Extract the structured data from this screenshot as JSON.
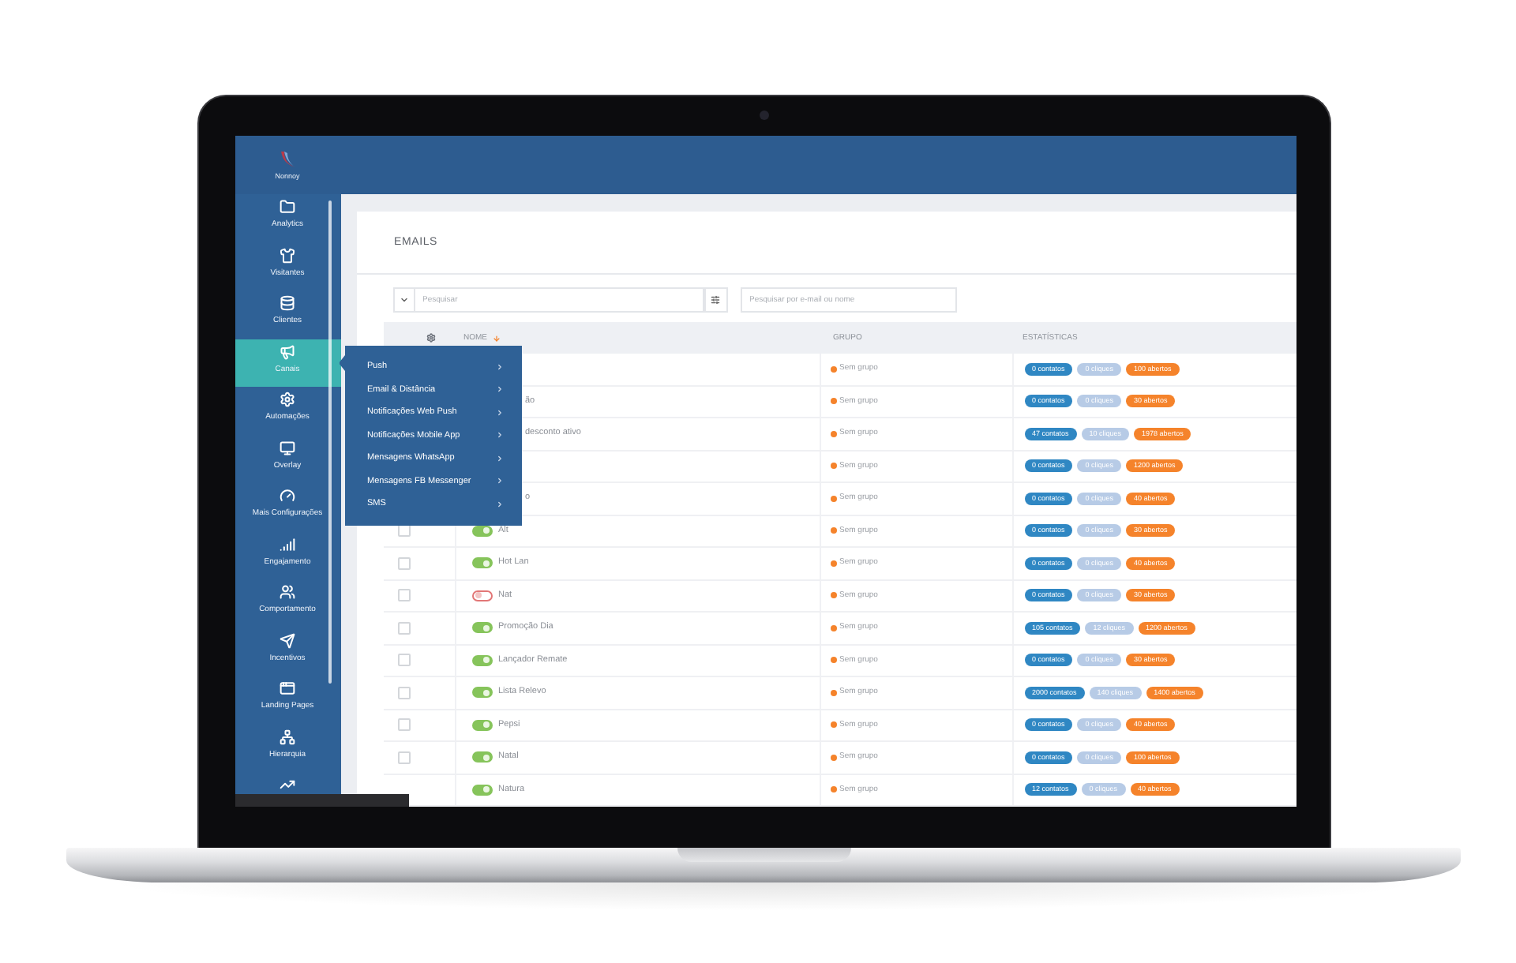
{
  "app": {
    "logo_text": "Nonnoy"
  },
  "sidebar": {
    "items": [
      {
        "label": "Analytics",
        "selected": false
      },
      {
        "label": "Visitantes",
        "selected": false
      },
      {
        "label": "Clientes",
        "selected": false
      },
      {
        "label": "Canais",
        "selected": true
      },
      {
        "label": "Automações",
        "selected": false
      },
      {
        "label": "Overlay",
        "selected": false
      },
      {
        "label": "Mais Configurações",
        "selected": false
      },
      {
        "label": "Engajamento",
        "selected": false
      },
      {
        "label": "Comportamento",
        "selected": false
      },
      {
        "label": "Incentivos",
        "selected": false
      },
      {
        "label": "Landing Pages",
        "selected": false
      },
      {
        "label": "Hierarquia",
        "selected": false
      },
      {
        "selected": false
      }
    ]
  },
  "channels_menu": {
    "items": [
      {
        "label": "Push"
      },
      {
        "label": "Email & Distância"
      },
      {
        "label": "Notificações Web Push"
      },
      {
        "label": "Notificações Mobile App"
      },
      {
        "label": "Mensagens WhatsApp"
      },
      {
        "label": "Mensagens FB Messenger"
      },
      {
        "label": "SMS"
      }
    ]
  },
  "page": {
    "title": "EMAILS"
  },
  "search": {
    "placeholder": "Pesquisar"
  },
  "filter": {
    "placeholder": "Pesquisar por e-mail ou nome"
  },
  "table": {
    "columns": [
      "NOME",
      "GRUPO",
      "ESTATÍSTICAS"
    ],
    "rows": [
      {
        "group": "Sem grupo",
        "stats": [
          {
            "text": "0 contatos",
            "color": "#2f87c3"
          },
          {
            "text": "0 cliques",
            "color": "#b7cbe6"
          },
          {
            "text": "100 abertos",
            "color": "#f5832b"
          }
        ]
      },
      {
        "name": "ão",
        "group": "Sem grupo",
        "stats": [
          {
            "text": "0 contatos",
            "color": "#2f87c3"
          },
          {
            "text": "0 cliques",
            "color": "#b7cbe6"
          },
          {
            "text": "30 abertos",
            "color": "#f5832b"
          }
        ]
      },
      {
        "name": "desconto ativo",
        "group": "Sem grupo",
        "stats": [
          {
            "text": "47 contatos",
            "color": "#2f87c3"
          },
          {
            "text": "10 cliques",
            "color": "#b7cbe6"
          },
          {
            "text": "1978 abertos",
            "color": "#f5832b"
          }
        ]
      },
      {
        "group": "Sem grupo",
        "stats": [
          {
            "text": "0 contatos",
            "color": "#2f87c3"
          },
          {
            "text": "0 cliques",
            "color": "#b7cbe6"
          },
          {
            "text": "1200 abertos",
            "color": "#f5832b"
          }
        ]
      },
      {
        "name": "o",
        "group": "Sem grupo",
        "stats": [
          {
            "text": "0 contatos",
            "color": "#2f87c3"
          },
          {
            "text": "0 cliques",
            "color": "#b7cbe6"
          },
          {
            "text": "40 abertos",
            "color": "#f5832b"
          }
        ]
      },
      {
        "checked": false,
        "enabled": true,
        "name": "Alt",
        "group": "Sem grupo",
        "stats": [
          {
            "text": "0 contatos",
            "color": "#2f87c3"
          },
          {
            "text": "0 cliques",
            "color": "#b7cbe6"
          },
          {
            "text": "30 abertos",
            "color": "#f5832b"
          }
        ]
      },
      {
        "checked": false,
        "enabled": true,
        "name": "Hot Lan",
        "group": "Sem grupo",
        "stats": [
          {
            "text": "0 contatos",
            "color": "#2f87c3"
          },
          {
            "text": "0 cliques",
            "color": "#b7cbe6"
          },
          {
            "text": "40 abertos",
            "color": "#f5832b"
          }
        ]
      },
      {
        "checked": false,
        "enabled": false,
        "name": "Nat",
        "group": "Sem grupo",
        "stats": [
          {
            "text": "0 contatos",
            "color": "#2f87c3"
          },
          {
            "text": "0 cliques",
            "color": "#b7cbe6"
          },
          {
            "text": "30 abertos",
            "color": "#f5832b"
          }
        ]
      },
      {
        "checked": false,
        "enabled": true,
        "name": "Promoção Dia",
        "group": "Sem grupo",
        "stats": [
          {
            "text": "105 contatos",
            "color": "#2f87c3"
          },
          {
            "text": "12 cliques",
            "color": "#b7cbe6"
          },
          {
            "text": "1200 abertos",
            "color": "#f5832b"
          }
        ]
      },
      {
        "checked": false,
        "enabled": true,
        "name": "Lançador Remate",
        "group": "Sem grupo",
        "stats": [
          {
            "text": "0 contatos",
            "color": "#2f87c3"
          },
          {
            "text": "0 cliques",
            "color": "#b7cbe6"
          },
          {
            "text": "30 abertos",
            "color": "#f5832b"
          }
        ]
      },
      {
        "checked": false,
        "enabled": true,
        "name": "Lista Relevo",
        "group": "Sem grupo",
        "stats": [
          {
            "text": "2000 contatos",
            "color": "#2f87c3"
          },
          {
            "text": "140 cliques",
            "color": "#b7cbe6"
          },
          {
            "text": "1400 abertos",
            "color": "#f5832b"
          }
        ]
      },
      {
        "checked": false,
        "enabled": true,
        "name": "Pepsi",
        "group": "Sem grupo",
        "stats": [
          {
            "text": "0 contatos",
            "color": "#2f87c3"
          },
          {
            "text": "0 cliques",
            "color": "#b7cbe6"
          },
          {
            "text": "40 abertos",
            "color": "#f5832b"
          }
        ]
      },
      {
        "checked": false,
        "enabled": true,
        "name": "Natal",
        "group": "Sem grupo",
        "stats": [
          {
            "text": "0 contatos",
            "color": "#2f87c3"
          },
          {
            "text": "0 cliques",
            "color": "#b7cbe6"
          },
          {
            "text": "100 abertos",
            "color": "#f5832b"
          }
        ]
      },
      {
        "enabled": true,
        "name": "Natura",
        "group": "Sem grupo",
        "stats": [
          {
            "text": "12 contatos",
            "color": "#2f87c3"
          },
          {
            "text": "0 cliques",
            "color": "#b7cbe6"
          },
          {
            "text": "40 abertos",
            "color": "#f5832b"
          }
        ]
      }
    ]
  }
}
